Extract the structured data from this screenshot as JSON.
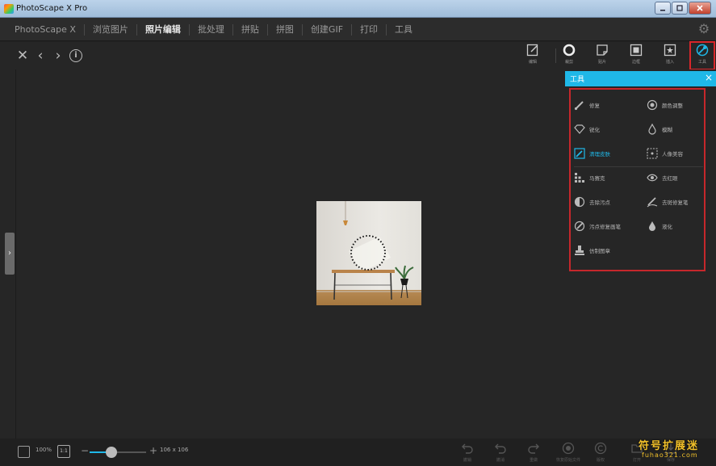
{
  "window": {
    "title": "PhotoScape X Pro",
    "minimize_icon": "minimize-icon",
    "maximize_icon": "maximize-icon",
    "close_icon": "close-icon"
  },
  "menu": {
    "tabs": [
      {
        "label": "PhotoScape X",
        "active": false
      },
      {
        "label": "浏览图片",
        "active": false
      },
      {
        "label": "照片编辑",
        "active": true
      },
      {
        "label": "批处理",
        "active": false
      },
      {
        "label": "拼贴",
        "active": false
      },
      {
        "label": "拼图",
        "active": false
      },
      {
        "label": "创建GIF",
        "active": false
      },
      {
        "label": "打印",
        "active": false
      },
      {
        "label": "工具",
        "active": false
      }
    ],
    "settings_icon": "gear-icon"
  },
  "nav": {
    "close_icon": "close-icon",
    "back_icon": "chevron-left-icon",
    "forward_icon": "chevron-right-icon",
    "info_icon": "info-icon",
    "info_glyph": "i"
  },
  "toolbar": {
    "tools": [
      {
        "label": "编辑",
        "icon": "edit-icon"
      },
      {
        "label": "裁剪",
        "icon": "circle-icon"
      },
      {
        "label": "贴片",
        "icon": "sticker-icon"
      },
      {
        "label": "边框",
        "icon": "frame-icon"
      },
      {
        "label": "插入",
        "icon": "insert-icon"
      },
      {
        "label": "工具",
        "icon": "tools-icon",
        "selected": true
      }
    ]
  },
  "panel": {
    "title": "工具",
    "close_glyph": "×",
    "accent": "#1fb8e8",
    "highlight_border": "#c6272b",
    "items": [
      {
        "label": "修复",
        "icon": "brush-icon"
      },
      {
        "label": "颜色调整",
        "icon": "color-adjust-icon"
      },
      {
        "label": "锐化",
        "icon": "diamond-icon"
      },
      {
        "label": "模糊",
        "icon": "drop-icon"
      },
      {
        "label": "清理皮肤",
        "icon": "skin-icon",
        "highlighted": true
      },
      {
        "label": "人像美容",
        "icon": "portrait-icon"
      },
      {
        "label": "马赛克",
        "icon": "mosaic-icon"
      },
      {
        "label": "去红眼",
        "icon": "eye-icon"
      },
      {
        "label": "去除污点",
        "icon": "spot-icon"
      },
      {
        "label": "去斑修复笔",
        "icon": "clone-icon"
      },
      {
        "label": "污点修复画笔",
        "icon": "heal-icon"
      },
      {
        "label": "液化",
        "icon": "liquify-icon"
      },
      {
        "label": "仿制图章",
        "icon": "stamp-icon"
      }
    ]
  },
  "bottom": {
    "zoom": "100%",
    "one_to_one": "1:1",
    "dimensions": "106 x 106",
    "minus": "−",
    "plus": "+",
    "actions": [
      {
        "label": "撤销",
        "icon": "undo-icon"
      },
      {
        "label": "撤消",
        "icon": "undo2-icon"
      },
      {
        "label": "重做",
        "icon": "redo-icon"
      },
      {
        "label": "恢复原始文件",
        "icon": "restore-icon"
      },
      {
        "label": "版权",
        "icon": "copyright-icon"
      },
      {
        "label": "打开",
        "icon": "open-icon"
      },
      {
        "label": "保存",
        "icon": "save-icon"
      }
    ]
  },
  "watermark": {
    "line1": "符号扩展迷",
    "line2": "fuhao321.com"
  }
}
